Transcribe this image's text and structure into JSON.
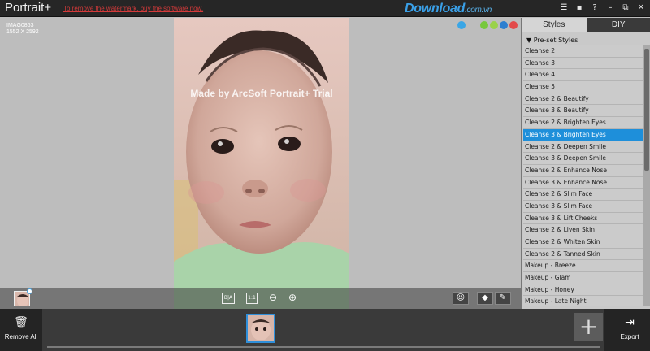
{
  "app": {
    "title": "Portrait+",
    "watermark_notice": "To remove the watermark, buy the software now.",
    "brand": "Download",
    "brand_suffix": ".com.vn",
    "window_controls": [
      "list-icon",
      "chat-icon",
      "help-icon",
      "minimize-icon",
      "restore-icon",
      "close-icon"
    ],
    "window_control_glyphs": [
      "☰",
      "▪",
      "?",
      "–",
      "⧉",
      "✕"
    ]
  },
  "canvas": {
    "file_name": "IMAG0863",
    "file_dims": "1552 X 2592",
    "overlay_text": "Made by ArcSoft Portrait+ Trial",
    "color_dots": [
      "#3aa6e6",
      "#78c83c",
      "#9ad24a",
      "#2d7fd0",
      "#e24a4a"
    ],
    "toolbar": {
      "before_after": "B|A",
      "one_to_one": "1:1",
      "zoom_out": "⊖",
      "zoom_in": "⊕",
      "face": "☺",
      "eraser": "◆",
      "brush": "✎"
    }
  },
  "panel": {
    "tabs": [
      "Styles",
      "DIY"
    ],
    "active_tab": "Styles",
    "preset_header": "Pre-set Styles",
    "presets": [
      "Cleanse 2",
      "Cleanse 3",
      "Cleanse 4",
      "Cleanse 5",
      "Cleanse 2 & Beautify",
      "Cleanse 3 & Beautify",
      "Cleanse 2 & Brighten Eyes",
      "Cleanse 3 & Brighten Eyes",
      "Cleanse 2 & Deepen Smile",
      "Cleanse 3 & Deepen Smile",
      "Cleanse 2 & Enhance Nose",
      "Cleanse 3 & Enhance Nose",
      "Cleanse 2 & Slim Face",
      "Cleanse 3 & Slim Face",
      "Cleanse 3 & Lift Cheeks",
      "Cleanse 2 & Liven Skin",
      "Cleanse 2 & Whiten Skin",
      "Cleanse 2 & Tanned Skin",
      "Makeup - Breeze",
      "Makeup - Glam",
      "Makeup - Honey",
      "Makeup - Late Night"
    ],
    "selected_preset": "Cleanse 3 & Brighten Eyes"
  },
  "bottom": {
    "remove_all": "Remove All",
    "export": "Export",
    "add": "+"
  },
  "colors": {
    "accent": "#1e8fda",
    "title_bar": "#262626",
    "watermark_link": "#d23a3a"
  }
}
